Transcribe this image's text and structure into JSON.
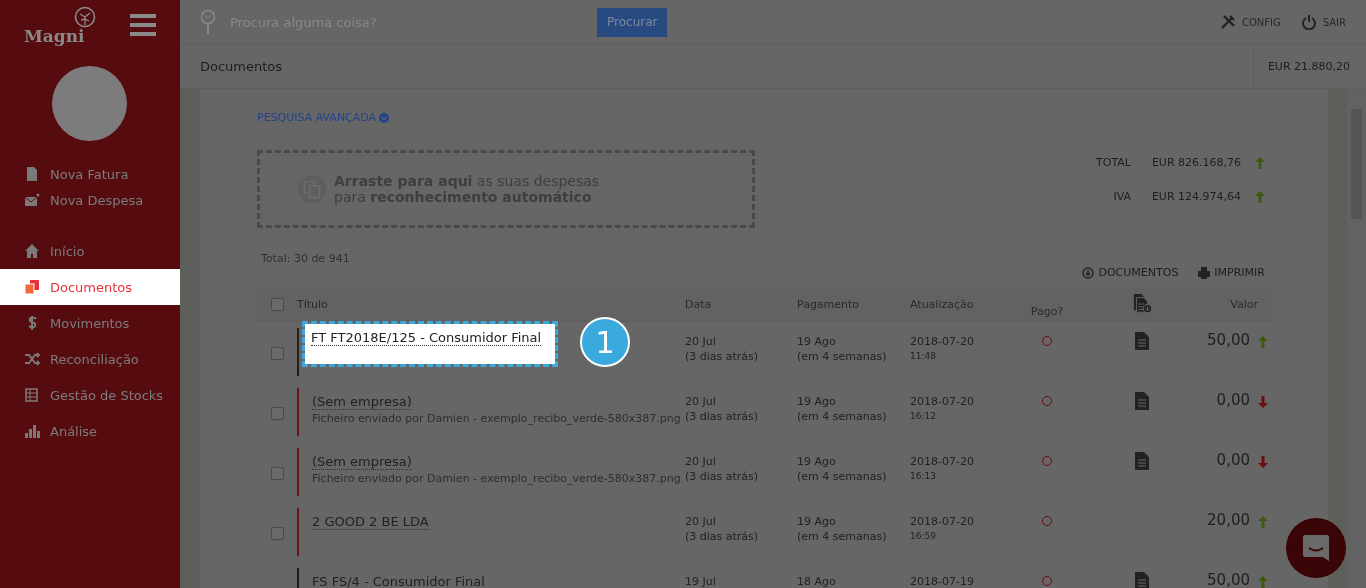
{
  "logo": {
    "text": "Magni"
  },
  "search": {
    "placeholder": "Procura alguma coisa?",
    "button": "Procurar"
  },
  "top_actions": [
    {
      "label": "CONFIG",
      "kind": "config"
    },
    {
      "label": "SAIR",
      "kind": "logout"
    }
  ],
  "sidebar": {
    "actions": [
      {
        "label": "Nova Fatura",
        "kind": "file"
      },
      {
        "label": "Nova Despesa",
        "kind": "mail"
      }
    ],
    "items": [
      {
        "label": "Início",
        "kind": "home",
        "selected": false
      },
      {
        "label": "Documentos",
        "kind": "docs",
        "selected": true
      },
      {
        "label": "Movimentos",
        "kind": "dollar",
        "selected": false
      },
      {
        "label": "Reconciliação",
        "kind": "shuffle",
        "selected": false
      },
      {
        "label": "Gestão de Stocks",
        "kind": "stock",
        "selected": false
      },
      {
        "label": "Análise",
        "kind": "chart",
        "selected": false
      }
    ]
  },
  "breadcrumb": "Documentos",
  "balance": "EUR 21.880,20",
  "advanced_search": "PESQUISA AVANÇADA",
  "dropzone": {
    "lines": [
      "**Arraste para aqui** as suas despesas",
      "para **reconhecimento automático**"
    ]
  },
  "totals": [
    {
      "label": "TOTAL",
      "value": "EUR 826.168,76",
      "rising": true
    },
    {
      "label": "IVA",
      "value": "EUR 124.974,64",
      "rising": true
    }
  ],
  "count": "Total: 30 de 941",
  "table_actions": [
    {
      "label": "DOCUMENTOS",
      "kind": "download"
    },
    {
      "label": "IMPRIMIR",
      "kind": "print"
    }
  ],
  "table": {
    "all_checked": false,
    "columns": [
      "Título",
      "Data",
      "Pagamento",
      "Atualização",
      "Pago?",
      "Valor"
    ],
    "rows": [
      {
        "title": "FT FT2018E/125 - Consumidor Final",
        "date": "20 Jul",
        "date_note": "(3 dias atrás)",
        "due": "19 Ago",
        "due_note": "(em 4 semanas)",
        "updated": "2018-07-20",
        "updated_time": "11:48",
        "checked": false,
        "paid": false,
        "has_document": true,
        "value": "50,00",
        "rising": true,
        "color": "#1e1e1e",
        "highlighted": true
      },
      {
        "title": "(Sem empresa)",
        "subtitle": "Ficheiro enviado por Damien - exemplo_recibo_verde-580x387.png",
        "date": "20 Jul",
        "date_note": "(3 dias atrás)",
        "due": "19 Ago",
        "due_note": "(em 4 semanas)",
        "updated": "2018-07-20",
        "updated_time": "16:12",
        "checked": false,
        "paid": false,
        "has_document": true,
        "value": "0,00",
        "rising": false,
        "color": "#6e1414",
        "highlighted": false
      },
      {
        "title": "(Sem empresa)",
        "subtitle": "Ficheiro enviado por Damien - exemplo_recibo_verde-580x387.png",
        "date": "20 Jul",
        "date_note": "(3 dias atrás)",
        "due": "19 Ago",
        "due_note": "(em 4 semanas)",
        "updated": "2018-07-20",
        "updated_time": "16:13",
        "checked": false,
        "paid": false,
        "has_document": true,
        "value": "0,00",
        "rising": false,
        "color": "#6e1414",
        "highlighted": false
      },
      {
        "title": "2 GOOD 2 BE LDA",
        "date": "20 Jul",
        "date_note": "(3 dias atrás)",
        "due": "19 Ago",
        "due_note": "(em 4 semanas)",
        "updated": "2018-07-20",
        "updated_time": "16:59",
        "checked": false,
        "paid": false,
        "has_document": false,
        "value": "20,00",
        "rising": true,
        "color": "#6e1414",
        "highlighted": false
      },
      {
        "title": "FS FS/4 - Consumidor Final",
        "date": "19 Jul",
        "due": "18 Ago",
        "updated": "2018-07-19",
        "paid": false,
        "has_document": true,
        "value": "50,00",
        "rising": true,
        "color": "#1e1e1e",
        "highlighted": false
      }
    ]
  },
  "tutorial": {
    "step": "1"
  }
}
